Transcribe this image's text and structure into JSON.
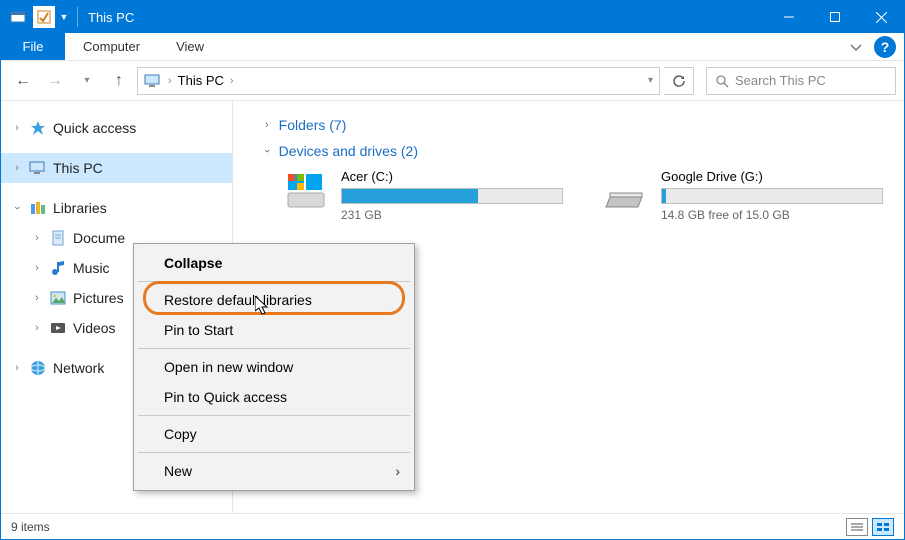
{
  "title": "This PC",
  "ribbon": {
    "file": "File",
    "tabs": [
      "Computer",
      "View"
    ]
  },
  "breadcrumb": {
    "location": "This PC"
  },
  "search": {
    "placeholder": "Search This PC"
  },
  "nav": {
    "quick_access": "Quick access",
    "this_pc": "This PC",
    "libraries": "Libraries",
    "lib_items": [
      "Docume",
      "Music",
      "Pictures",
      "Videos"
    ],
    "network": "Network"
  },
  "groups": {
    "folders": {
      "label": "Folders",
      "count": 7
    },
    "devices": {
      "label": "Devices and drives",
      "count": 2
    }
  },
  "drives": [
    {
      "name": "Acer (C:)",
      "free_text": "231 GB",
      "fill_pct": 62
    },
    {
      "name": "Google Drive (G:)",
      "free_text": "14.8 GB free of 15.0 GB",
      "fill_pct": 2
    }
  ],
  "context_menu": {
    "collapse": "Collapse",
    "restore": "Restore default libraries",
    "pin_start": "Pin to Start",
    "open_new": "Open in new window",
    "pin_quick": "Pin to Quick access",
    "copy": "Copy",
    "new": "New"
  },
  "status": {
    "items": "9 items"
  }
}
